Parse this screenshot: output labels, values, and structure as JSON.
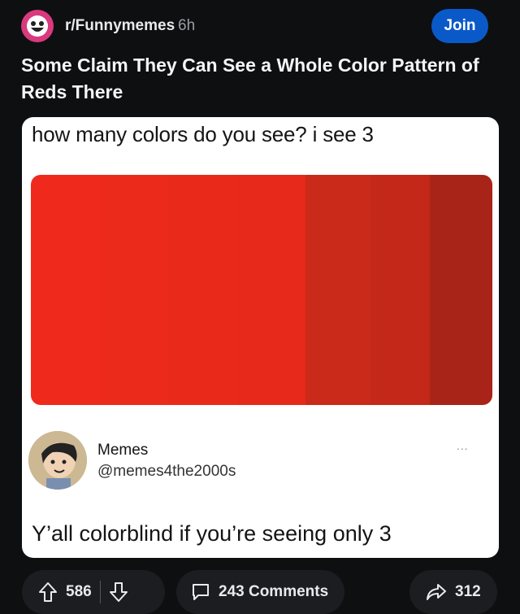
{
  "header": {
    "subreddit": "r/Funnymemes",
    "age": "6h",
    "join_label": "Join"
  },
  "post": {
    "title": "Some Claim They Can See a Whole Color Pattern of Reds There"
  },
  "image": {
    "question": "how many colors do you see? i see 3",
    "swatch_colors": [
      "#ef2a1d",
      "#ec2a1c",
      "#e92a1b",
      "#e6291a",
      "#c92a1a",
      "#c42818",
      "#a92418"
    ],
    "tweet": {
      "name": "Memes",
      "handle": "@memes4the2000s",
      "more": "...",
      "text": "Y’all colorblind if you’re seeing only 3"
    }
  },
  "actions": {
    "upvotes": "586",
    "comments": "243 Comments",
    "shares": "312"
  },
  "colors": {
    "join_button": "#0a59c9",
    "background": "#0e0f11",
    "pill": "#1c1d21"
  }
}
